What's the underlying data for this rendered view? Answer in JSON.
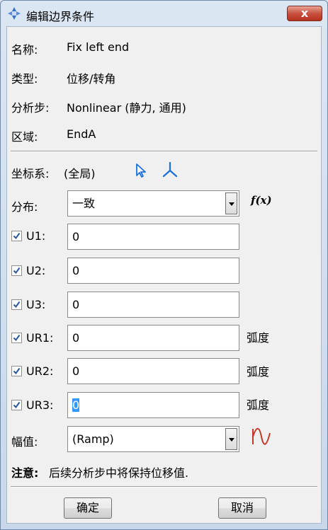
{
  "window": {
    "title": "编辑边界条件",
    "close_label": "x"
  },
  "info": {
    "name_label": "名称:",
    "name_value": "Fix left end",
    "type_label": "类型:",
    "type_value": "位移/转角",
    "step_label": "分析步:",
    "step_value": "Nonlinear (静力, 通用)",
    "region_label": "区域:",
    "region_value": "EndA"
  },
  "csys": {
    "label": "坐标系:",
    "value": "(全局)"
  },
  "distribution": {
    "label": "分布:",
    "value": "一致",
    "fx_label": "f(x)"
  },
  "dofs": [
    {
      "label": "U1:",
      "checked": true,
      "value": "0",
      "unit": ""
    },
    {
      "label": "U2:",
      "checked": true,
      "value": "0",
      "unit": ""
    },
    {
      "label": "U3:",
      "checked": true,
      "value": "0",
      "unit": ""
    },
    {
      "label": "UR1:",
      "checked": true,
      "value": "0",
      "unit": "弧度"
    },
    {
      "label": "UR2:",
      "checked": true,
      "value": "0",
      "unit": "弧度"
    },
    {
      "label": "UR3:",
      "checked": true,
      "value": "0",
      "unit": "弧度"
    }
  ],
  "amplitude": {
    "label": "幅值:",
    "value": "(Ramp)"
  },
  "note": {
    "prefix": "注意:",
    "text": "后续分析步中将保持位移值."
  },
  "buttons": {
    "ok": "确定",
    "cancel": "取消"
  },
  "colors": {
    "titlebar": "#dbe6f3",
    "client": "#f0f0f0",
    "close": "#c8523f",
    "selection": "#3399ff",
    "icon_blue": "#1e6fd9",
    "amp_curve": "#c0392b"
  }
}
